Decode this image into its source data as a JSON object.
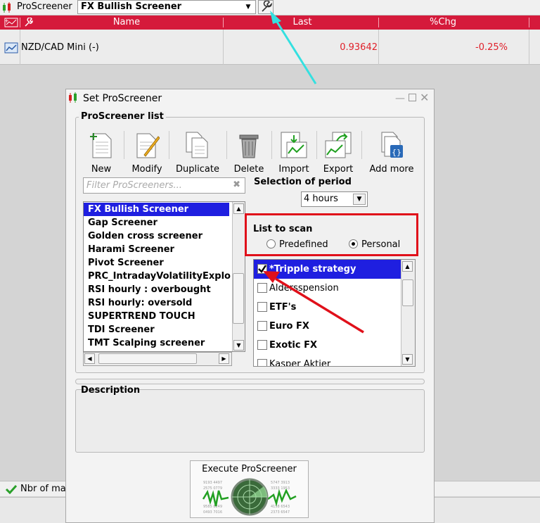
{
  "app": {
    "title": "ProScreener",
    "selected_screener": "FX Bullish Screener"
  },
  "table": {
    "columns": [
      "Name",
      "Last",
      "%Chg"
    ],
    "rows": [
      {
        "name": "NZD/CAD Mini (-)",
        "last": "0.93642",
        "chg": "-0.25%"
      }
    ]
  },
  "status": {
    "text": "Nbr of mat"
  },
  "dialog": {
    "title": "Set ProScreener",
    "list_group": "ProScreener list",
    "toolbar": [
      "New",
      "Modify",
      "Duplicate",
      "Delete",
      "Import",
      "Export",
      "Add more"
    ],
    "filter_placeholder": "Filter ProScreeners...",
    "screeners": [
      "FX Bullish Screener",
      "Gap Screener",
      "Golden cross screener",
      "Harami Screener",
      "Pivot Screener",
      "PRC_IntradayVolatilityExplo",
      "RSI hourly : overbought",
      "RSI hourly: oversold",
      "SUPERTREND TOUCH",
      "TDI Screener",
      "TMT Scalping screener"
    ],
    "period_label": "Selection of period",
    "period_value": "4 hours",
    "scan_label": "List to scan",
    "scan_options": [
      "Predefined",
      "Personal"
    ],
    "scan_selected": "Personal",
    "scan_lists": [
      {
        "name": "*Tripple strategy",
        "checked": true
      },
      {
        "name": "Aldersspension",
        "checked": false
      },
      {
        "name": "ETF's",
        "checked": false
      },
      {
        "name": "Euro FX",
        "checked": false
      },
      {
        "name": "Exotic FX",
        "checked": false
      },
      {
        "name": "Kasper Aktier",
        "checked": false
      }
    ],
    "description_label": "Description",
    "execute_label": "Execute ProScreener"
  },
  "colors": {
    "header_red": "#d51a3b",
    "selection_blue": "#1f1fe0",
    "annotation_red": "#e0101a",
    "annotation_cyan": "#34e0e0"
  }
}
